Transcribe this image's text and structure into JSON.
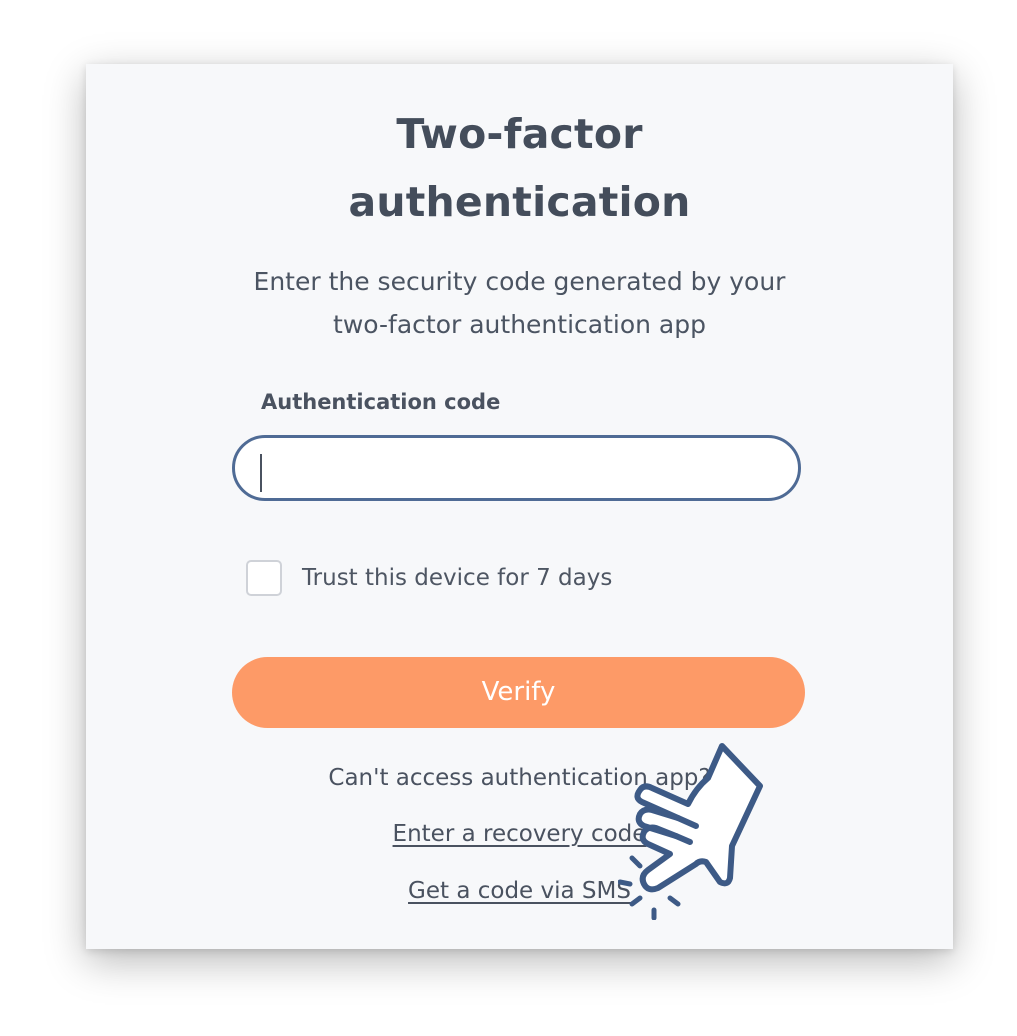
{
  "dialog": {
    "title_line1": "Two-factor",
    "title_line2": "authentication",
    "subtitle_line1": "Enter the security code generated by your",
    "subtitle_line2": "two-factor authentication app"
  },
  "form": {
    "code_label": "Authentication code",
    "code_value": "",
    "trust_label": "Trust this device for 7 days",
    "trust_checked": false,
    "verify_label": "Verify"
  },
  "alternatives": {
    "prompt": "Can't access authentication app?",
    "recovery_link": "Enter a recovery code",
    "sms_link": "Get a code via SMS"
  },
  "colors": {
    "card_background": "#f7f8fa",
    "text": "#444d5b",
    "input_border": "#4f6b95",
    "button_accent": "#fd9a67",
    "cursor_outline": "#3d5a86"
  },
  "icons": {
    "cursor": "pointing-hand-cursor-icon"
  }
}
